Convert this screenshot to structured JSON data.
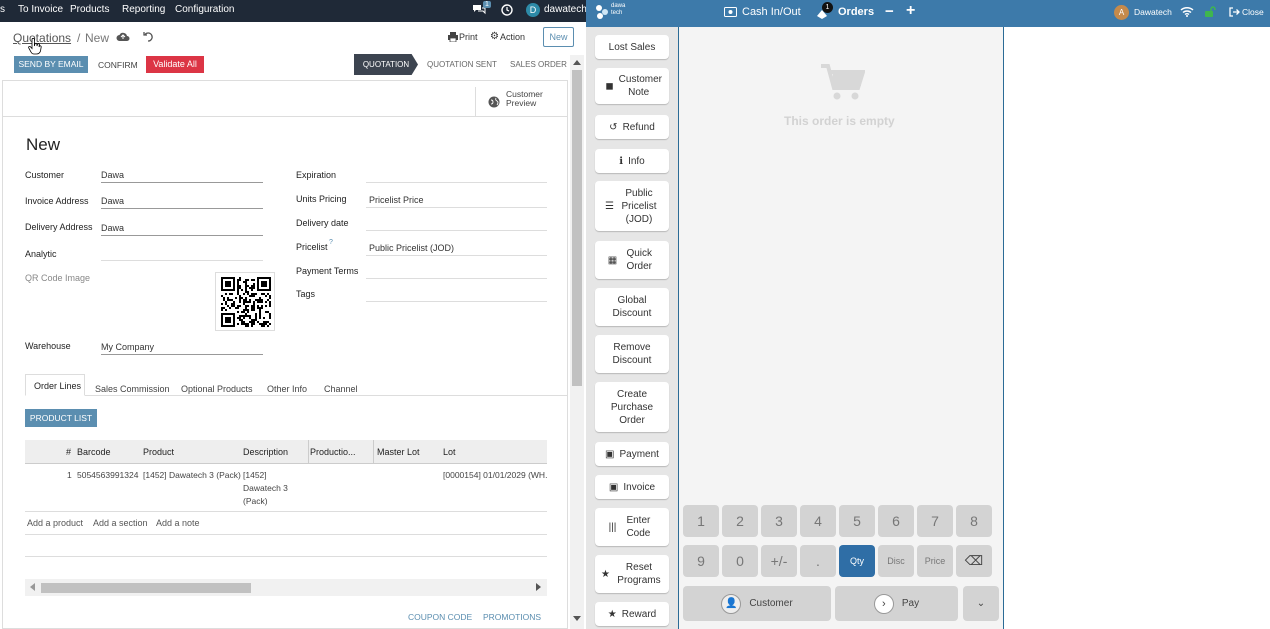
{
  "topnav": {
    "menu": [
      "s",
      "To Invoice",
      "Products",
      "Reporting",
      "Configuration"
    ],
    "chat_count": "1",
    "user_initial": "D",
    "user_name": "dawatech"
  },
  "control_panel": {
    "breadcrumb_parent": "Quotations",
    "breadcrumb_sep": "/",
    "breadcrumb_current": "New",
    "print_label": "Print",
    "action_label": "Action",
    "new_label": "New",
    "send_email_label": "SEND BY EMAIL",
    "confirm_label": "CONFIRM",
    "validate_label": "Validate All",
    "statuses": [
      "QUOTATION",
      "QUOTATION SENT",
      "SALES ORDER"
    ]
  },
  "form": {
    "customer_preview_l1": "Customer",
    "customer_preview_l2": "Preview",
    "title": "New",
    "left_fields": [
      {
        "label": "Customer",
        "value": "Dawa"
      },
      {
        "label": "Invoice Address",
        "value": "Dawa"
      },
      {
        "label": "Delivery Address",
        "value": "Dawa"
      },
      {
        "label": "Analytic",
        "value": ""
      },
      {
        "label": "QR Code Image",
        "value": ""
      },
      {
        "label": "Warehouse",
        "value": "My Company"
      }
    ],
    "right_fields": [
      {
        "label": "Expiration",
        "value": ""
      },
      {
        "label": "Units Pricing",
        "value": "Pricelist Price"
      },
      {
        "label": "Delivery date",
        "value": ""
      },
      {
        "label": "Pricelist",
        "value": "Public Pricelist (JOD)"
      },
      {
        "label": "Payment Terms",
        "value": ""
      },
      {
        "label": "Tags",
        "value": ""
      }
    ],
    "pricelist_help": "?",
    "tabs": [
      "Order Lines",
      "Sales Commission",
      "Optional Products",
      "Other Info",
      "Channel"
    ],
    "product_list_label": "PRODUCT LIST",
    "columns": [
      "#",
      "Barcode",
      "Product",
      "Description",
      "Productio...",
      "Master Lot",
      "Lot"
    ],
    "row": {
      "num": "1",
      "barcode": "5054563991324",
      "product": "[1452] Dawatech 3 (Pack)",
      "desc1": "[1452]",
      "desc2": "Dawatech 3",
      "desc3": "(Pack)",
      "lot": "[0000154] 01/01/2029 (WH..."
    },
    "add_product": "Add a product",
    "add_section": "Add a section",
    "add_note": "Add a note",
    "coupon_code": "COUPON CODE",
    "promotions": "PROMOTIONS"
  },
  "pos": {
    "logo_text_1": "dawa",
    "logo_text_2": "tech",
    "cash_in_out": "Cash In/Out",
    "orders_label": "Orders",
    "orders_badge": "1",
    "minus": "−",
    "plus": "+",
    "cashier_initial": "A",
    "cashier_name": "Dawatech",
    "close_label": "Close",
    "control_buttons": [
      "Lost Sales",
      "Customer Note",
      "Refund",
      "Info",
      "Public Pricelist (JOD)",
      "Quick Order",
      "Global Discount",
      "Remove Discount",
      "Create Purchase Order",
      "Payment",
      "Invoice",
      "Enter Code",
      "Reset Programs",
      "Reward"
    ],
    "empty_text": "This order is empty",
    "keys_row1": [
      "1",
      "2",
      "3",
      "4",
      "5",
      "6",
      "7",
      "8"
    ],
    "keys_row2": [
      "9",
      "0",
      "+/-",
      ".",
      "Qty",
      "Disc",
      "Price",
      "⌫"
    ],
    "customer_label": "Customer",
    "pay_label": "Pay",
    "colors": {
      "pos_bar": "#3d7aaa",
      "qty_active": "#2f6ea6",
      "danger": "#dc3545",
      "odoo_primary": "#5b8eb0"
    }
  }
}
